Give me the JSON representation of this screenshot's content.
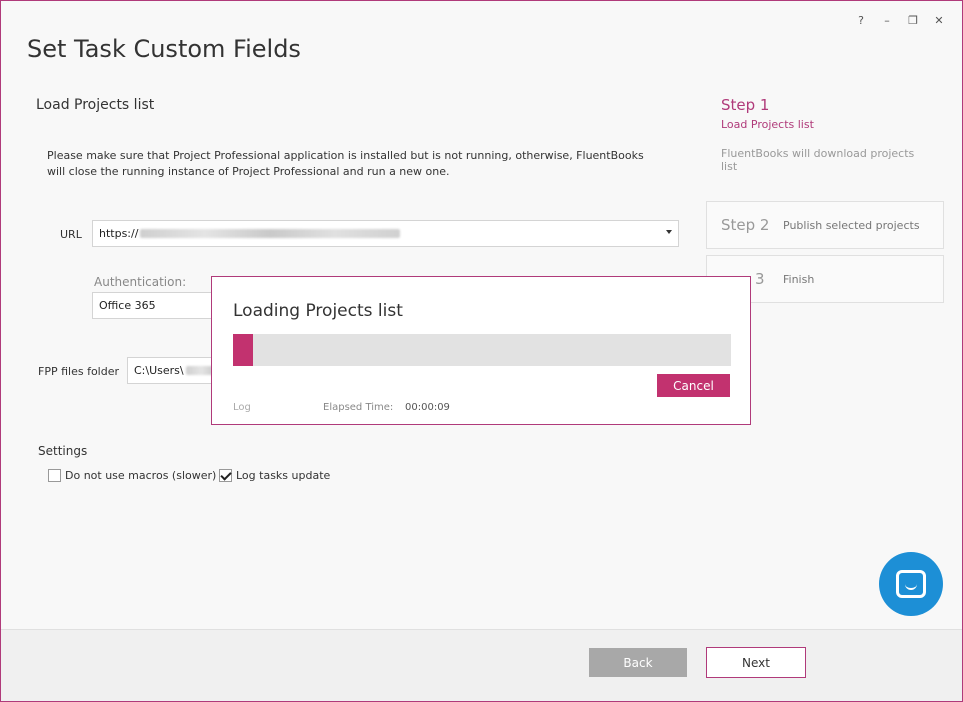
{
  "window": {
    "controls": [
      "?",
      "–",
      "❐",
      "✕"
    ]
  },
  "title": "Set Task Custom Fields",
  "section_title": "Load Projects list",
  "info_text": "Please make sure that Project Professional application is installed but is not running, otherwise, FluentBooks will close the running instance of Project Professional and run a new one.",
  "url": {
    "label": "URL",
    "value": "https://"
  },
  "authentication": {
    "label": "Authentication:",
    "value": "Office 365"
  },
  "fpp_folder": {
    "label": "FPP files folder",
    "value": "C:\\Users\\"
  },
  "settings": {
    "title": "Settings",
    "options": [
      {
        "label": "Do not use macros (slower)",
        "checked": false
      },
      {
        "label": "Log tasks update",
        "checked": true
      }
    ]
  },
  "steps": [
    {
      "name": "Step 1",
      "subtitle": "Load Projects list",
      "description": "FluentBooks will download projects list",
      "active": true
    },
    {
      "name": "Step 2",
      "subtitle": "Publish selected projects",
      "active": false
    },
    {
      "name": "3",
      "subtitle": "Finish",
      "active": false
    }
  ],
  "footer": {
    "back_label": "Back",
    "next_label": "Next"
  },
  "modal": {
    "title": "Loading Projects list",
    "progress": 0.04,
    "cancel_label": "Cancel",
    "log_label": "Log",
    "elapsed_label": "Elapsed Time:",
    "elapsed_value": "00:00:09"
  },
  "colors": {
    "accent": "#b03a7a",
    "progress": "#c2326f",
    "chat": "#1d8fd6"
  },
  "icons": {
    "chat": "chat-bubble-icon",
    "dropdown": "chevron-down-icon",
    "checkmark": "checkmark-icon"
  }
}
